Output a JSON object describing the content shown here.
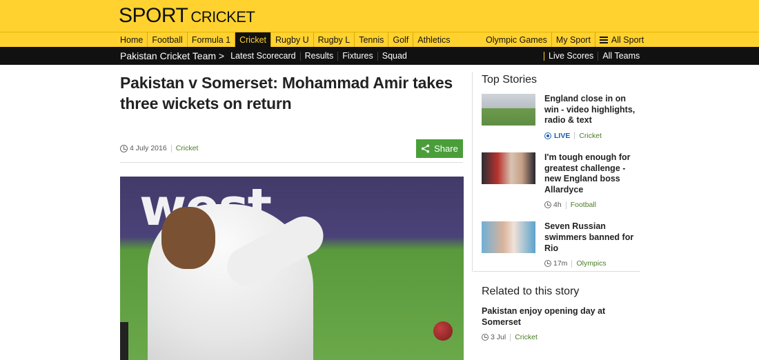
{
  "brand": {
    "title": "SPORT",
    "section": "CRICKET"
  },
  "primary_nav": {
    "left": [
      {
        "label": "Home"
      },
      {
        "label": "Football"
      },
      {
        "label": "Formula 1"
      },
      {
        "label": "Cricket",
        "active": true
      },
      {
        "label": "Rugby U"
      },
      {
        "label": "Rugby L"
      },
      {
        "label": "Tennis"
      },
      {
        "label": "Golf"
      },
      {
        "label": "Athletics"
      }
    ],
    "right": [
      {
        "label": "Olympic Games"
      },
      {
        "label": "My Sport"
      },
      {
        "label": "All Sport"
      }
    ]
  },
  "secondary_nav": {
    "team": "Pakistan Cricket Team >",
    "left": [
      {
        "label": "Latest Scorecard"
      },
      {
        "label": "Results"
      },
      {
        "label": "Fixtures"
      },
      {
        "label": "Squad"
      }
    ],
    "right": [
      {
        "label": "Live Scores"
      },
      {
        "label": "All Teams"
      }
    ]
  },
  "article": {
    "headline": "Pakistan v Somerset: Mohammad Amir takes three wickets on return",
    "date": "4 July 2016",
    "section": "Cricket",
    "share_label": "Share",
    "image_banner_text": "west"
  },
  "sidebar": {
    "heading": "Top Stories",
    "stories": [
      {
        "title": "England close in on win - video highlights, radio & text",
        "status": "LIVE",
        "section": "Cricket"
      },
      {
        "title": "I'm tough enough for greatest challenge - new England boss Allardyce",
        "time": "4h",
        "section": "Football"
      },
      {
        "title": "Seven Russian swimmers banned for Rio",
        "time": "17m",
        "section": "Olympics"
      }
    ]
  },
  "related": {
    "heading": "Related to this story",
    "items": [
      {
        "title": "Pakistan enjoy opening day at Somerset",
        "time": "3 Jul",
        "section": "Cricket"
      }
    ]
  },
  "colors": {
    "brand_yellow": "#ffd230",
    "nav_black": "#111111",
    "share_green": "#4a9e3a",
    "link_green": "#4a7b27",
    "live_blue": "#1a5dad"
  }
}
